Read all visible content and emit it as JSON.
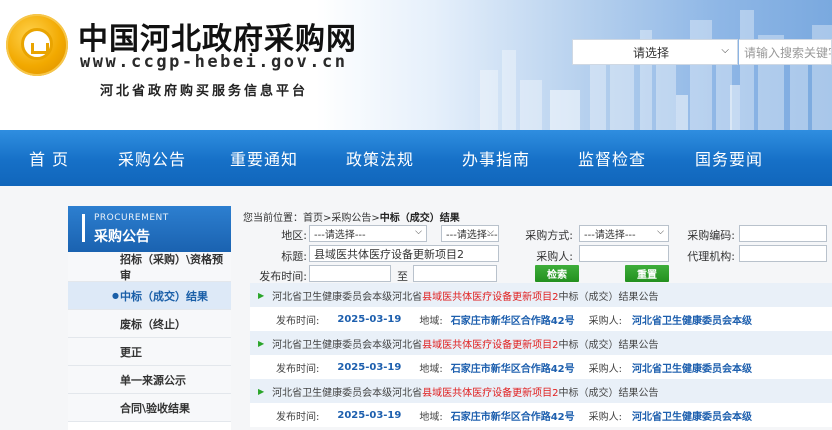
{
  "header": {
    "title": "中国河北政府采购网",
    "url": "www.ccgp-hebei.gov.cn",
    "subtitle": "河北省政府购买服务信息平台",
    "search_select": "请选择",
    "search_placeholder": "请输入搜索关键字"
  },
  "nav": {
    "items": [
      {
        "label": "首 页"
      },
      {
        "label": "采购公告"
      },
      {
        "label": "重要通知"
      },
      {
        "label": "政策法规"
      },
      {
        "label": "办事指南"
      },
      {
        "label": "监督检查"
      },
      {
        "label": "国务要闻"
      }
    ]
  },
  "sidebar": {
    "head_en": "PROCUREMENT",
    "head_zh": "采购公告",
    "items": [
      {
        "label": "招标（采购）\\资格预审"
      },
      {
        "label": "中标（成交）结果"
      },
      {
        "label": "废标（终止）"
      },
      {
        "label": "更正"
      },
      {
        "label": "单一来源公示"
      },
      {
        "label": "合同\\验收结果"
      }
    ]
  },
  "breadcrumb": {
    "prefix": "您当前位置：",
    "path": "首页>采购公告>",
    "current": "中标（成交）结果"
  },
  "filters": {
    "region_label": "地区:",
    "region_value1": "---请选择---",
    "region_value2": "---请选择---",
    "method_label": "采购方式:",
    "method_value": "---请选择---",
    "code_label": "采购编码:",
    "code_value": "",
    "title_label": "标题:",
    "title_value": "县域医共体医疗设备更新项目2",
    "buyer_label": "采购人:",
    "buyer_value": "",
    "agency_label": "代理机构:",
    "agency_value": "",
    "date_label": "发布时间:",
    "date_from": "",
    "date_to_label": "至",
    "date_to": "",
    "search_btn": "检索",
    "reset_btn": "重置"
  },
  "results": [
    {
      "prefix": "河北省卫生健康委员会本级河北省",
      "highlight": "县域医共体医疗设备更新项目2",
      "suffix": "中标（成交）结果公告",
      "date_label": "发布时间:",
      "date": "2025-03-19",
      "region_label": "地域:",
      "region": "石家庄市新华区合作路42号",
      "buyer_label": "采购人:",
      "buyer": "河北省卫生健康委员会本级"
    },
    {
      "prefix": "河北省卫生健康委员会本级河北省",
      "highlight": "县域医共体医疗设备更新项目2",
      "suffix": "中标（成交）结果公告",
      "date_label": "发布时间:",
      "date": "2025-03-19",
      "region_label": "地域:",
      "region": "石家庄市新华区合作路42号",
      "buyer_label": "采购人:",
      "buyer": "河北省卫生健康委员会本级"
    },
    {
      "prefix": "河北省卫生健康委员会本级河北省",
      "highlight": "县域医共体医疗设备更新项目2",
      "suffix": "中标（成交）结果公告",
      "date_label": "发布时间:",
      "date": "2025-03-19",
      "region_label": "地域:",
      "region": "石家庄市新华区合作路42号",
      "buyer_label": "采购人:",
      "buyer": "河北省卫生健康委员会本级"
    }
  ],
  "colors": {
    "nav_blue": "#1670c7",
    "link_blue": "#1d5fae",
    "highlight_red": "#e02020",
    "button_green": "#23901f"
  }
}
